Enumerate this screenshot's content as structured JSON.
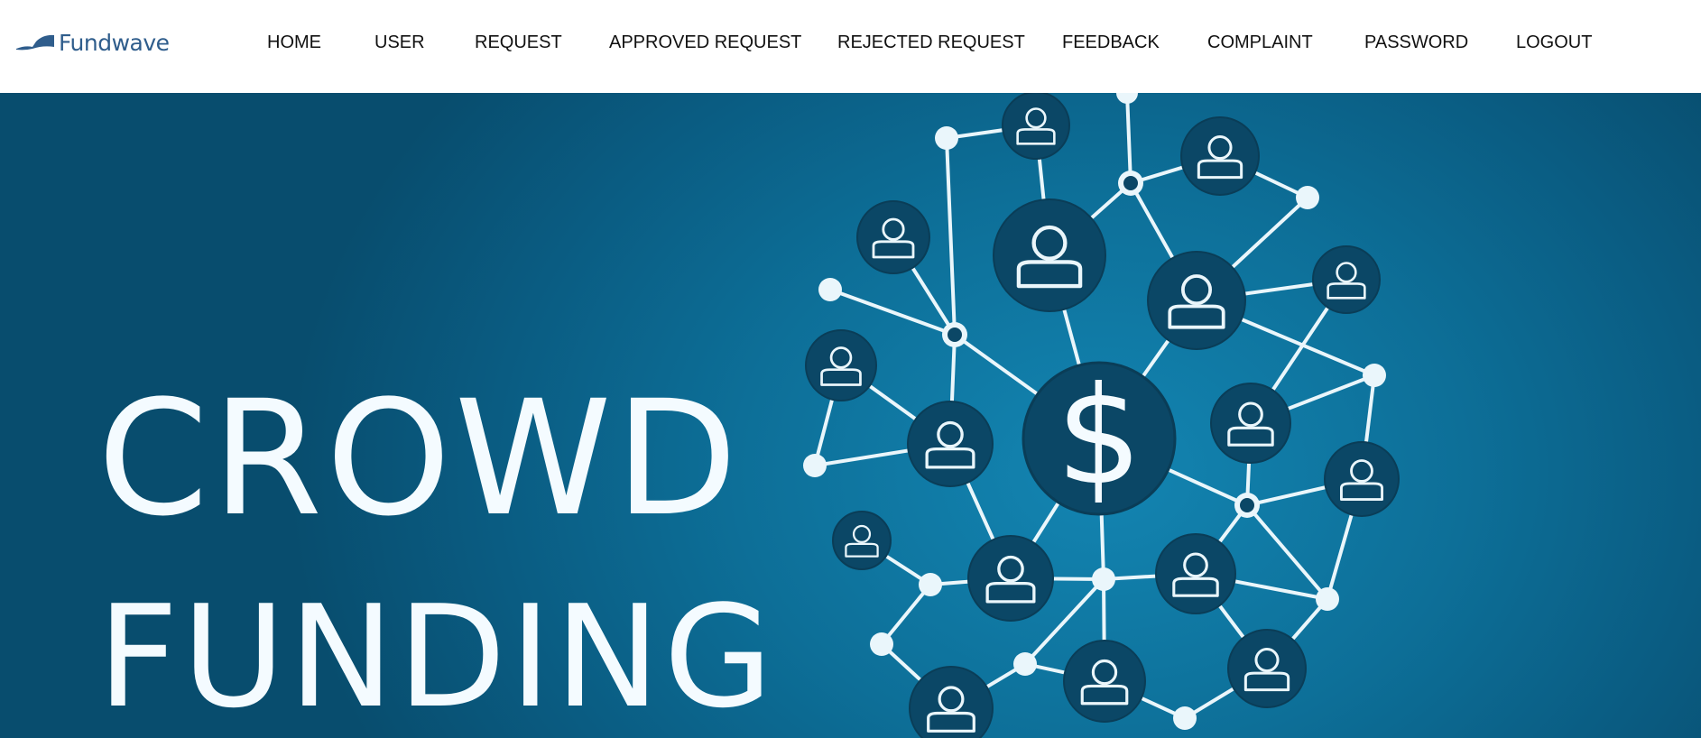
{
  "brand": {
    "name": "Fundwave",
    "color": "#2f5d8c"
  },
  "nav": {
    "items": [
      {
        "label": "HOME"
      },
      {
        "label": "USER"
      },
      {
        "label": "REQUEST"
      },
      {
        "label": "APPROVED REQUEST"
      },
      {
        "label": "REJECTED REQUEST"
      },
      {
        "label": "FEEDBACK"
      },
      {
        "label": "COMPLAINT"
      },
      {
        "label": "PASSWORD"
      },
      {
        "label": "LOGOUT"
      }
    ]
  },
  "hero": {
    "line1": "CROWD",
    "line2": "FUNDING",
    "center_symbol": "$",
    "icon": "crowd-network-illustration",
    "colors": {
      "background": "#0d6f98",
      "dark_circle": "#0b4766",
      "line": "#eaf6fb"
    }
  }
}
